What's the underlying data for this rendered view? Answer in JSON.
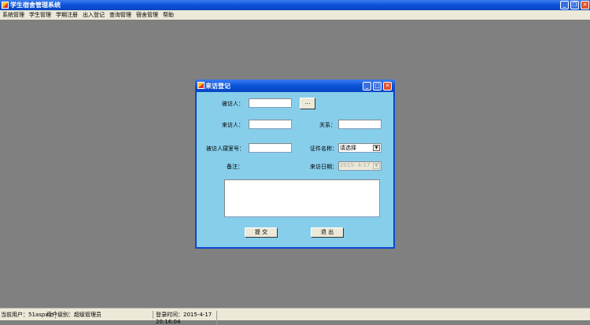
{
  "app": {
    "title": "学生宿舍管理系统",
    "menu": [
      "系统管理",
      "学生管理",
      "学期注册",
      "出入登记",
      "查询管理",
      "宿舍管理",
      "帮助"
    ]
  },
  "dialog": {
    "title": "来访登记",
    "visited_label": "被访人：",
    "visited_value": "",
    "browse_label": "...",
    "visitor_label": "来访人：",
    "visitor_value": "",
    "relation_label": "关系：",
    "relation_value": "",
    "room_label": "被访人寝室号：",
    "room_value": "",
    "id_type_label": "证件名称：",
    "id_type_value": "请选择",
    "remark_label": "备注：",
    "remark_value": "",
    "date_label": "来访日期：",
    "date_value": "2015- 4-17",
    "submit_label": "提 交",
    "exit_label": "退 出"
  },
  "status": {
    "user": "当前用户：51aspx.n",
    "level": "用户级别：超级管理员",
    "login_time": "登录时间：2015-4-17 20:16:04"
  }
}
